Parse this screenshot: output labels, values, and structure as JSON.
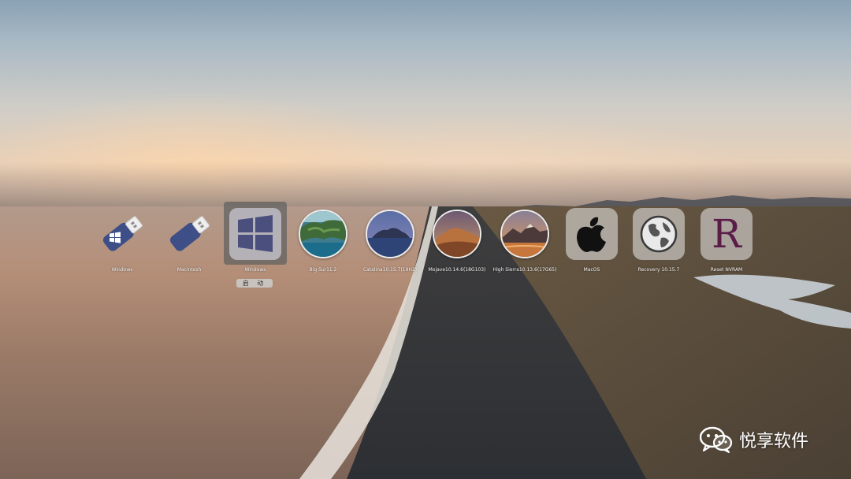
{
  "boot_picker": {
    "entries": [
      {
        "label": "Windows",
        "icon": "usb-drive-windows-icon"
      },
      {
        "label": "Macintosh",
        "icon": "usb-drive-icon"
      },
      {
        "label": "Windows",
        "icon": "windows-logo-icon",
        "selected": true
      },
      {
        "label": "Big Sur11.2",
        "icon": "big-sur-icon"
      },
      {
        "label": "Catalina10.15.7(19H2)",
        "icon": "catalina-icon"
      },
      {
        "label": "Mojave10.14.6(18G103)",
        "icon": "mojave-icon"
      },
      {
        "label": "High Sierra10.13.6(17G65)",
        "icon": "high-sierra-icon"
      },
      {
        "label": "MacOS",
        "icon": "apple-logo-icon"
      },
      {
        "label": "Recovery 10.15.7",
        "icon": "globe-icon"
      },
      {
        "label": "Reset NVRAM",
        "icon": "reset-r-icon",
        "icon_text": "R"
      }
    ],
    "boot_button_label": "启 动"
  },
  "watermark": {
    "text": "悦享软件",
    "icon": "wechat-icon"
  },
  "colors": {
    "usb_drive": "#3d4f86",
    "windows_logo": "#4a4f7e",
    "selected_tile": "#5f5f5f",
    "reset_letter": "#5b1c4a"
  }
}
